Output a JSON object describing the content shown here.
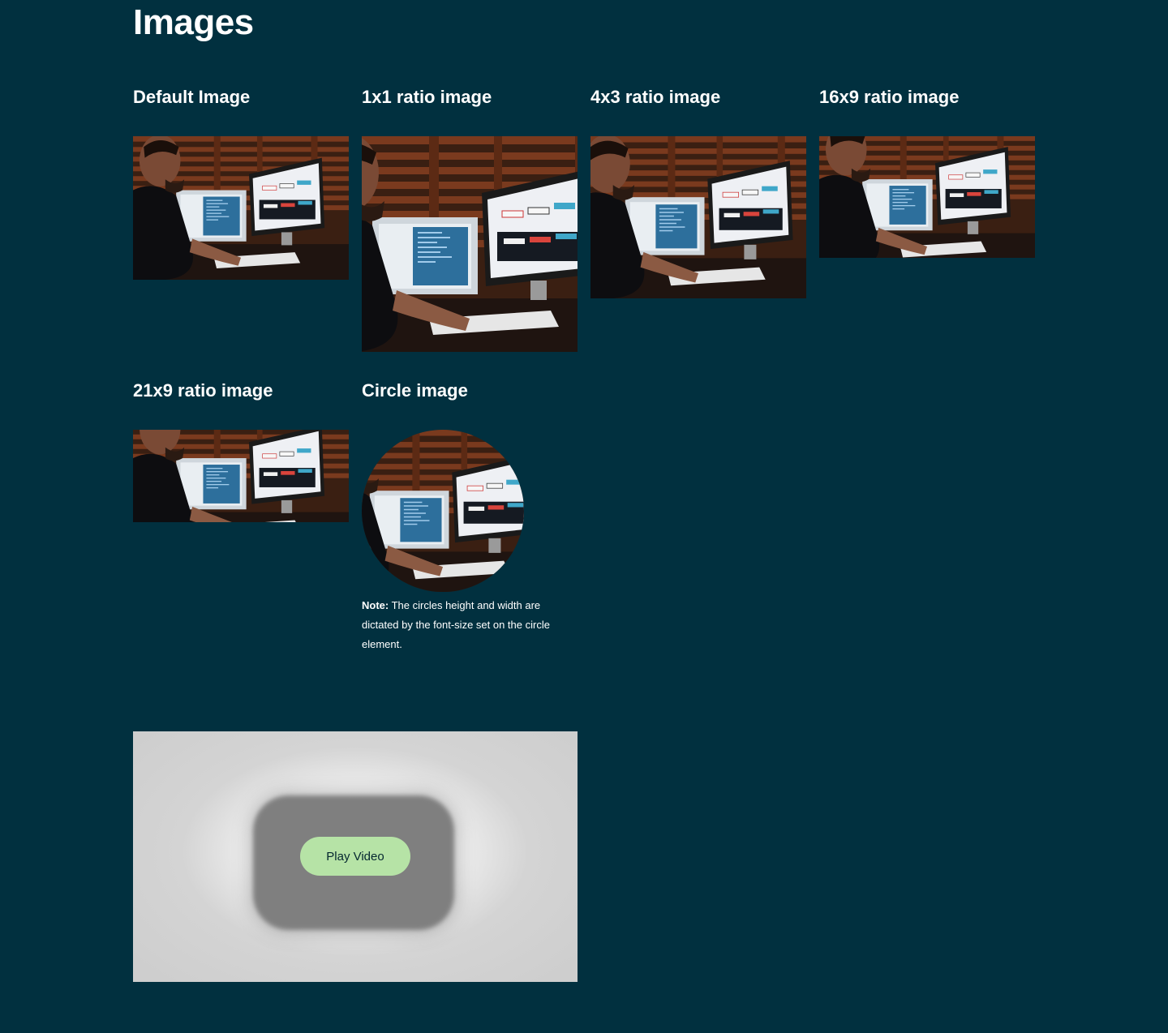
{
  "page": {
    "title": "Images"
  },
  "cards": {
    "default": {
      "title": "Default Image"
    },
    "ratio_1x1": {
      "title": "1x1 ratio image"
    },
    "ratio_4x3": {
      "title": "4x3 ratio image"
    },
    "ratio_16x9": {
      "title": "16x9 ratio image"
    },
    "ratio_21x9": {
      "title": "21x9 ratio image"
    },
    "circle": {
      "title": "Circle image",
      "note_label": "Note:",
      "note_text": "The circles height and width are dictated by the font-size set on the circle element."
    }
  },
  "video": {
    "play_label": "Play Video"
  },
  "colors": {
    "background": "#01303f",
    "text": "#ffffff",
    "play_button": "#b6e3a6",
    "play_button_text": "#04262f"
  }
}
